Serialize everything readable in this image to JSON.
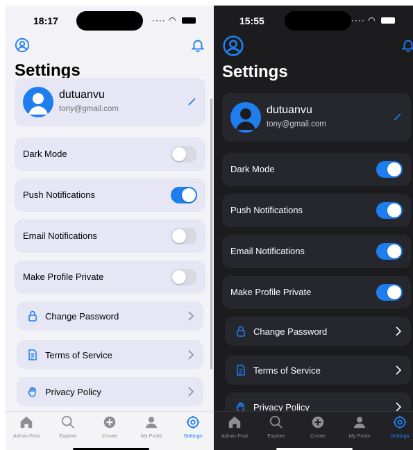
{
  "light": {
    "status": {
      "time": "18:17"
    },
    "title": "Settings",
    "profile": {
      "name": "dutuanvu",
      "email": "tony@gmail.com"
    },
    "toggles": [
      {
        "label": "Dark Mode",
        "on": false
      },
      {
        "label": "Push Notifications",
        "on": true
      },
      {
        "label": "Email Notifications",
        "on": false
      },
      {
        "label": "Make Profile Private",
        "on": false
      }
    ],
    "links": [
      {
        "label": "Change Password",
        "icon": "lock-icon"
      },
      {
        "label": "Terms of Service",
        "icon": "document-icon"
      },
      {
        "label": "Privacy Policy",
        "icon": "hand-icon"
      }
    ],
    "tabs": [
      {
        "label": "Admin Post",
        "icon": "house-icon",
        "active": false
      },
      {
        "label": "Explore",
        "icon": "search-icon",
        "active": false
      },
      {
        "label": "Create",
        "icon": "plus-circle-icon",
        "active": false
      },
      {
        "label": "My Posts",
        "icon": "person-icon",
        "active": false
      },
      {
        "label": "Settings",
        "icon": "gear-icon",
        "active": true
      }
    ]
  },
  "dark": {
    "status": {
      "time": "15:55"
    },
    "title": "Settings",
    "profile": {
      "name": "dutuanvu",
      "email": "tony@gmail.com"
    },
    "toggles": [
      {
        "label": "Dark Mode",
        "on": true
      },
      {
        "label": "Push Notifications",
        "on": true
      },
      {
        "label": "Email Notifications",
        "on": true
      },
      {
        "label": "Make Profile Private",
        "on": true
      }
    ],
    "links": [
      {
        "label": "Change Password",
        "icon": "lock-icon"
      },
      {
        "label": "Terms of Service",
        "icon": "document-icon"
      },
      {
        "label": "Privacy Policy",
        "icon": "hand-icon"
      }
    ],
    "tabs": [
      {
        "label": "Admin Post",
        "icon": "house-icon",
        "active": false
      },
      {
        "label": "Explore",
        "icon": "search-icon",
        "active": false
      },
      {
        "label": "Create",
        "icon": "plus-circle-icon",
        "active": false
      },
      {
        "label": "My Posts",
        "icon": "person-icon",
        "active": false
      },
      {
        "label": "Settings",
        "icon": "gear-icon",
        "active": true
      }
    ]
  },
  "colors": {
    "accent": "#1e7ef0",
    "light_card": "#e6e6f5",
    "dark_card": "#26262d",
    "dark_bg": "#1c1c1e"
  }
}
